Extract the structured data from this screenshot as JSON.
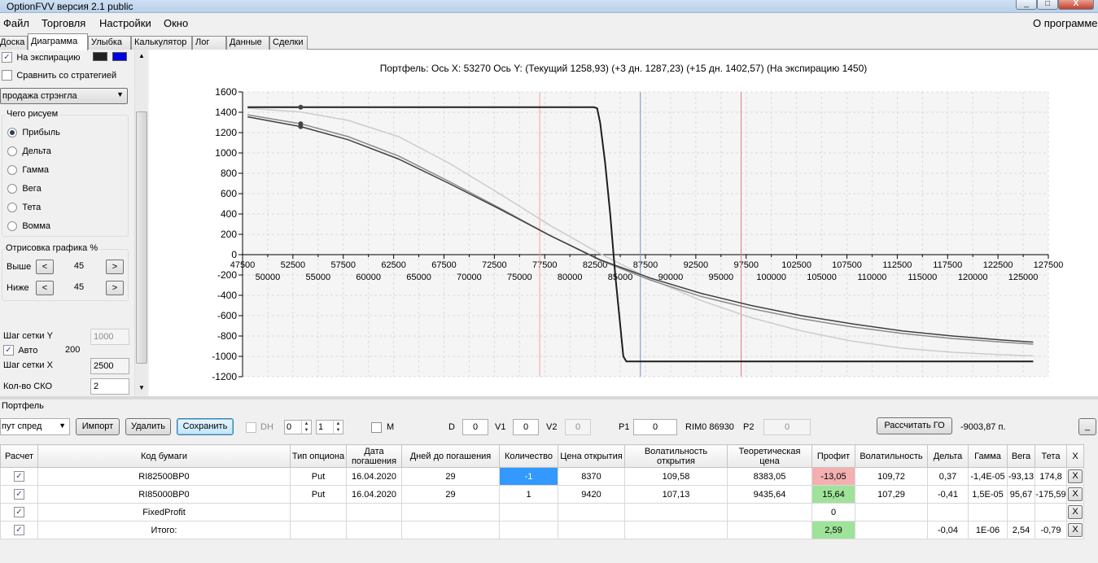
{
  "window": {
    "title": "OptionFVV версия 2.1 public",
    "controls": [
      "_",
      "□",
      "X"
    ]
  },
  "menu": {
    "file": "Файл",
    "trade": "Торговля",
    "settings": "Настройки",
    "window": "Окно",
    "about": "О программе"
  },
  "tabs": [
    "Доска",
    "Диаграмма",
    "Улыбка",
    "Калькулятор",
    "Лог",
    "Данные",
    "Сделки"
  ],
  "left": {
    "expiry_label": "На экспирацию",
    "compare_label": "Сравнить со стратегией",
    "strategy_select": "продажа стрэнгла",
    "draw_group": "Чего рисуем",
    "draw_options": [
      "Прибыль",
      "Дельта",
      "Гамма",
      "Вега",
      "Тета",
      "Вомма"
    ],
    "render_group": "Отрисовка графика %",
    "above_label": "Выше",
    "above_value": "45",
    "below_label": "Ниже",
    "below_value": "45",
    "prev_glyph": "<",
    "next_glyph": ">",
    "grid_y_label": "Шаг сетки Y",
    "grid_y_value": "1000",
    "auto_label": "Авто",
    "auto_value": "200",
    "grid_x_label": "Шаг сетки X",
    "grid_x_value": "2500",
    "sko_label": "Кол-во СКО",
    "sko_value": "2"
  },
  "chart_caption": "Портфель:  Ось X:  53270  Ось Y:   (Текущий  1258,93)   (+3 дн.  1287,23)   (+15 дн.  1402,57)   (На экспирацию  1450)",
  "chart_data": {
    "type": "line",
    "ylim": [
      -1200,
      1600
    ],
    "xlim": [
      47500,
      127500
    ],
    "y_ticks": [
      "1600",
      "1400",
      "1200",
      "1000",
      "800",
      "600",
      "400",
      "200",
      "0",
      "-200",
      "-400",
      "-600",
      "-800",
      "-1000",
      "-1200"
    ],
    "x_ticks_upper": [
      "47500",
      "52500",
      "57500",
      "62500",
      "67500",
      "72500",
      "77500",
      "82500",
      "87500",
      "92500",
      "97500",
      "102500",
      "107500",
      "112500",
      "117500",
      "122500",
      "127500"
    ],
    "x_ticks_lower": [
      "50000",
      "55000",
      "60000",
      "65000",
      "70000",
      "75000",
      "80000",
      "85000",
      "90000",
      "95000",
      "100000",
      "105000",
      "110000",
      "115000",
      "120000",
      "125000"
    ],
    "vlines": [
      {
        "x": 77000,
        "color": "#f2a0a0"
      },
      {
        "x": 87000,
        "color": "#6f8fc0"
      },
      {
        "x": 97000,
        "color": "#e07a7a"
      }
    ],
    "series": [
      {
        "color": "#1e1e1e",
        "points": [
          [
            48000,
            1450
          ],
          [
            53270,
            1450
          ],
          [
            82400,
            1450
          ],
          [
            82700,
            1440
          ],
          [
            83000,
            1300
          ],
          [
            83500,
            900
          ],
          [
            84000,
            400
          ],
          [
            84500,
            -200
          ],
          [
            85000,
            -700
          ],
          [
            85300,
            -1000
          ],
          [
            85600,
            -1050
          ],
          [
            126000,
            -1050
          ]
        ]
      },
      {
        "color": "#404040",
        "points": [
          [
            48000,
            1355
          ],
          [
            53270,
            1259
          ],
          [
            58000,
            1130
          ],
          [
            63000,
            940
          ],
          [
            68000,
            700
          ],
          [
            73000,
            450
          ],
          [
            78000,
            190
          ],
          [
            83000,
            -50
          ],
          [
            88000,
            -230
          ],
          [
            93000,
            -380
          ],
          [
            98000,
            -500
          ],
          [
            103000,
            -600
          ],
          [
            108000,
            -680
          ],
          [
            113000,
            -750
          ],
          [
            118000,
            -800
          ],
          [
            123000,
            -840
          ],
          [
            126000,
            -860
          ]
        ]
      },
      {
        "color": "#8a8a8a",
        "points": [
          [
            48000,
            1375
          ],
          [
            53270,
            1287
          ],
          [
            58000,
            1160
          ],
          [
            63000,
            970
          ],
          [
            68000,
            720
          ],
          [
            73000,
            460
          ],
          [
            78000,
            190
          ],
          [
            83000,
            -55
          ],
          [
            88000,
            -250
          ],
          [
            93000,
            -410
          ],
          [
            98000,
            -530
          ],
          [
            103000,
            -630
          ],
          [
            108000,
            -710
          ],
          [
            113000,
            -775
          ],
          [
            118000,
            -825
          ],
          [
            123000,
            -860
          ],
          [
            126000,
            -880
          ]
        ]
      },
      {
        "color": "#cccccc",
        "points": [
          [
            48000,
            1440
          ],
          [
            53270,
            1403
          ],
          [
            58000,
            1320
          ],
          [
            63000,
            1160
          ],
          [
            68000,
            900
          ],
          [
            73000,
            600
          ],
          [
            78000,
            290
          ],
          [
            83000,
            10
          ],
          [
            88000,
            -240
          ],
          [
            93000,
            -450
          ],
          [
            98000,
            -620
          ],
          [
            103000,
            -750
          ],
          [
            108000,
            -850
          ],
          [
            113000,
            -920
          ],
          [
            118000,
            -960
          ],
          [
            123000,
            -985
          ],
          [
            126000,
            -995
          ]
        ]
      }
    ],
    "markers": [
      [
        53270,
        1450
      ],
      [
        53270,
        1259
      ],
      [
        53270,
        1287
      ]
    ]
  },
  "portfolio": {
    "group_label": "Портфель",
    "strategy_select": "пут спред",
    "import": "Импорт",
    "delete": "Удалить",
    "save": "Сохранить",
    "dh_label": "DH",
    "dh_spin1": "0",
    "dh_spin2": "1",
    "m_label": "M",
    "d_label": "D",
    "d_value": "0",
    "v1_label": "V1",
    "v1_value": "0",
    "v2_label": "V2",
    "v2_value": "0",
    "p1_label": "P1",
    "p1_value": "0",
    "rim_label": "RIM0 86930",
    "p2_label": "P2",
    "p2_value": "0",
    "calc_go": "Рассчитать ГО",
    "go_value": "-9003,87 п.",
    "minimize": "_"
  },
  "grid": {
    "headers": [
      "Расчет",
      "Код бумаги",
      "Тип опциона",
      "Дата погашения",
      "Дней до погашения",
      "Количество",
      "Цена открытия",
      "Волатильность открытия",
      "Теоретическая цена",
      "Профит",
      "Волатильность",
      "Дельта",
      "Гамма",
      "Вега",
      "Тета",
      "X"
    ],
    "rows": [
      {
        "check": "✓",
        "code": "RI82500BP0",
        "type": "Put",
        "date": "16.04.2020",
        "days": "29",
        "qty": "-1",
        "price": "8370",
        "vol_open": "109,58",
        "theo": "8383,05",
        "profit": "-13,05",
        "vol": "109,72",
        "delta": "0,37",
        "gamma": "-1,4E-05",
        "vega": "-93,13",
        "theta": "174,8",
        "x": "X"
      },
      {
        "check": "✓",
        "code": "RI85000BP0",
        "type": "Put",
        "date": "16.04.2020",
        "days": "29",
        "qty": "1",
        "price": "9420",
        "vol_open": "107,13",
        "theo": "9435,64",
        "profit": "15,64",
        "vol": "107,29",
        "delta": "-0,41",
        "gamma": "1,5E-05",
        "vega": "95,67",
        "theta": "-175,59",
        "x": "X"
      },
      {
        "check": "✓",
        "code": "FixedProfit",
        "type": "",
        "date": "",
        "days": "",
        "qty": "",
        "price": "",
        "vol_open": "",
        "theo": "",
        "profit": "0",
        "vol": "",
        "delta": "",
        "gamma": "",
        "vega": "",
        "theta": "",
        "x": "X"
      },
      {
        "check": "✓",
        "code": "Итого:",
        "type": "",
        "date": "",
        "days": "",
        "qty": "",
        "price": "",
        "vol_open": "",
        "theo": "",
        "profit": "2,59",
        "vol": "",
        "delta": "-0,04",
        "gamma": "1E-06",
        "vega": "2,54",
        "theta": "-0,79",
        "x": "X"
      }
    ]
  }
}
